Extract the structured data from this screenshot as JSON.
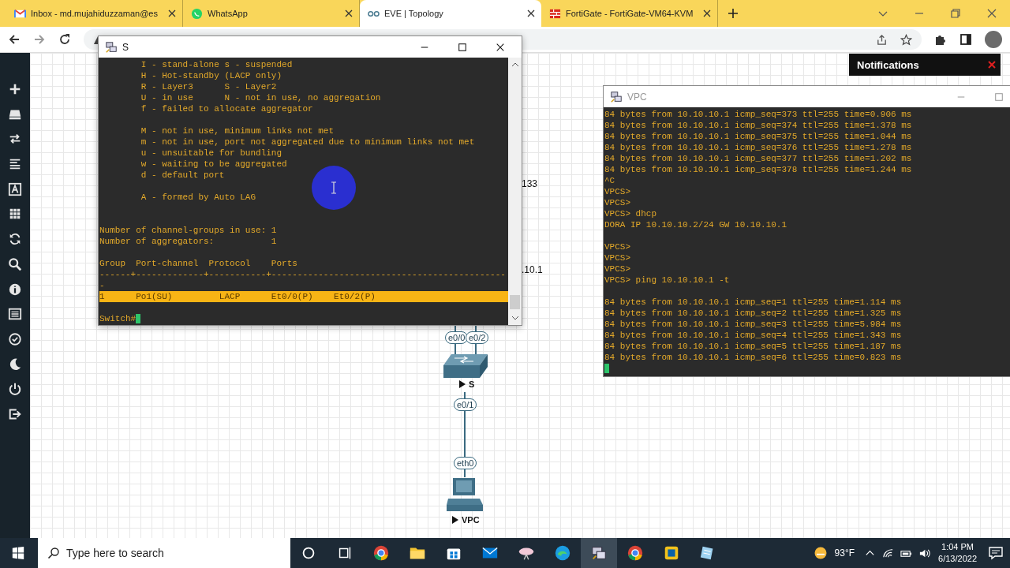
{
  "browser": {
    "tabs": [
      {
        "label": "Inbox - md.mujahiduzzaman@es",
        "kind": "mail",
        "selected": false
      },
      {
        "label": "WhatsApp",
        "kind": "chat",
        "selected": false
      },
      {
        "label": "EVE | Topology",
        "kind": "topology",
        "selected": true
      },
      {
        "label": "FortiGate - FortiGate-VM64-KVM",
        "kind": "firewall",
        "selected": false
      }
    ]
  },
  "sidebar": {
    "items": [
      {
        "kind": "add"
      },
      {
        "kind": "storage"
      },
      {
        "kind": "swap"
      },
      {
        "kind": "lines"
      },
      {
        "kind": "text"
      },
      {
        "kind": "grid"
      },
      {
        "kind": "refresh"
      },
      {
        "kind": "zoom"
      },
      {
        "kind": "info"
      },
      {
        "kind": "list"
      },
      {
        "kind": "check"
      },
      {
        "kind": "moon"
      },
      {
        "kind": "power"
      },
      {
        "kind": "logout"
      }
    ]
  },
  "notifications": {
    "title": "Notifications"
  },
  "canvas_labels": [
    "133",
    ".10.1"
  ],
  "topology": {
    "ports": [
      "e0/0",
      "e0/2",
      "e0/1",
      "eth0"
    ],
    "nodes": [
      {
        "label": "S",
        "kind": "switch"
      },
      {
        "label": "VPC",
        "kind": "pc"
      }
    ]
  },
  "windows": [
    {
      "title": "S",
      "active": true,
      "lines": [
        {
          "text": "        I - stand-alone s - suspended"
        },
        {
          "text": "        H - Hot-standby (LACP only)"
        },
        {
          "text": "        R - Layer3      S - Layer2"
        },
        {
          "text": "        U - in use      N - not in use, no aggregation"
        },
        {
          "text": "        f - failed to allocate aggregator"
        },
        {
          "kind": "blank"
        },
        {
          "text": "        M - not in use, minimum links not met"
        },
        {
          "text": "        m - not in use, port not aggregated due to minimum links not met"
        },
        {
          "text": "        u - unsuitable for bundling"
        },
        {
          "text": "        w - waiting to be aggregated"
        },
        {
          "text": "        d - default port"
        },
        {
          "kind": "blank"
        },
        {
          "text": "        A - formed by Auto LAG"
        },
        {
          "kind": "blank"
        },
        {
          "kind": "blank"
        },
        {
          "text": "Number of channel-groups in use: 1"
        },
        {
          "text": "Number of aggregators:           1"
        },
        {
          "kind": "blank"
        },
        {
          "text": "Group  Port-channel  Protocol    Ports"
        },
        {
          "text": "------+-------------+-----------+---------------------------------------------"
        },
        {
          "text": "-"
        },
        {
          "text": "1      Po1(SU)         LACP      Et0/0(P)    Et0/2(P)",
          "kind": "highlight"
        },
        {
          "kind": "blank"
        },
        {
          "text": "Switch#",
          "kind": "prompt"
        }
      ]
    },
    {
      "title": "VPC",
      "active": false,
      "lines": [
        {
          "text": "84 bytes from 10.10.10.1 icmp_seq=373 ttl=255 time=0.906 ms"
        },
        {
          "text": "84 bytes from 10.10.10.1 icmp_seq=374 ttl=255 time=1.378 ms"
        },
        {
          "text": "84 bytes from 10.10.10.1 icmp_seq=375 ttl=255 time=1.044 ms"
        },
        {
          "text": "84 bytes from 10.10.10.1 icmp_seq=376 ttl=255 time=1.278 ms"
        },
        {
          "text": "84 bytes from 10.10.10.1 icmp_seq=377 ttl=255 time=1.202 ms"
        },
        {
          "text": "84 bytes from 10.10.10.1 icmp_seq=378 ttl=255 time=1.244 ms"
        },
        {
          "text": "^C"
        },
        {
          "text": "VPCS>"
        },
        {
          "text": "VPCS>"
        },
        {
          "text": "VPCS> dhcp"
        },
        {
          "text": "DORA IP 10.10.10.2/24 GW 10.10.10.1"
        },
        {
          "kind": "blank"
        },
        {
          "text": "VPCS>"
        },
        {
          "text": "VPCS>"
        },
        {
          "text": "VPCS>"
        },
        {
          "text": "VPCS> ping 10.10.10.1 -t"
        },
        {
          "kind": "blank"
        },
        {
          "text": "84 bytes from 10.10.10.1 icmp_seq=1 ttl=255 time=1.114 ms"
        },
        {
          "text": "84 bytes from 10.10.10.1 icmp_seq=2 ttl=255 time=1.325 ms"
        },
        {
          "text": "84 bytes from 10.10.10.1 icmp_seq=3 ttl=255 time=5.984 ms"
        },
        {
          "text": "84 bytes from 10.10.10.1 icmp_seq=4 ttl=255 time=1.343 ms"
        },
        {
          "text": "84 bytes from 10.10.10.1 icmp_seq=5 ttl=255 time=1.187 ms"
        },
        {
          "text": "84 bytes from 10.10.10.1 icmp_seq=6 ttl=255 time=0.823 ms"
        },
        {
          "kind": "cursor"
        }
      ]
    }
  ],
  "taskbar": {
    "search": {
      "placeholder": "Type here to search"
    },
    "apps": [
      {
        "kind": "circle",
        "selected": false
      },
      {
        "kind": "taskview",
        "selected": false
      },
      {
        "kind": "chrome",
        "selected": false
      },
      {
        "kind": "folder",
        "selected": false
      },
      {
        "kind": "store",
        "selected": false
      },
      {
        "kind": "mail",
        "selected": false
      },
      {
        "kind": "dish",
        "selected": false
      },
      {
        "kind": "edge",
        "selected": false
      },
      {
        "kind": "terminal",
        "selected": true
      },
      {
        "kind": "chrome",
        "selected": false
      },
      {
        "kind": "square",
        "selected": false
      },
      {
        "kind": "notepad",
        "selected": false
      }
    ],
    "weather": "93°F",
    "time": "1:04 PM",
    "date": "6/13/2022"
  }
}
